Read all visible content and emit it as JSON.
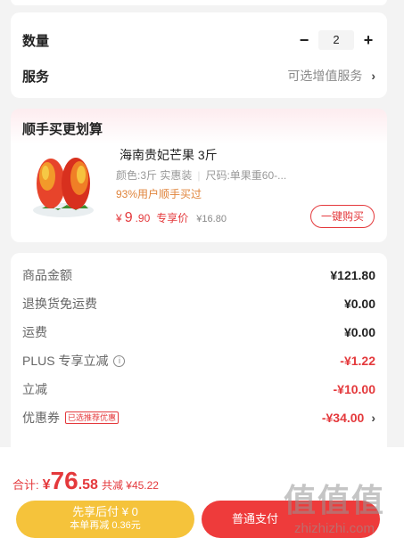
{
  "quantity": {
    "label": "数量",
    "minus": "−",
    "plus": "+",
    "value": "2"
  },
  "service": {
    "label": "服务",
    "value": "可选增值服务",
    "chevron": "›"
  },
  "bundle": {
    "title": "顺手买更划算",
    "product": {
      "name": "海南贵妃芒果 3斤",
      "spec_color": "颜色:3斤 实惠装",
      "spec_size": "尺码:单果重60-...",
      "buy_rate": "93%用户顺手买过",
      "price_yen": "¥",
      "price_int": "9",
      "price_dec": ".90",
      "price_tag": "专享价",
      "orig_price": "¥16.80",
      "buy_button": "一键购买"
    }
  },
  "summary": {
    "rows": [
      {
        "label": "商品金额",
        "value": "¥121.80"
      },
      {
        "label": "退换货免运费",
        "value": "¥0.00"
      },
      {
        "label": "运费",
        "value": "¥0.00"
      },
      {
        "label": "PLUS 专享立减",
        "value": "-¥1.22"
      },
      {
        "label": "立减",
        "value": "-¥10.00"
      },
      {
        "label": "优惠券",
        "tag": "已选推荐优惠",
        "value": "-¥34.00"
      }
    ]
  },
  "footer": {
    "total_label": "合计:",
    "total_yen": "¥",
    "total_int": "76",
    "total_dec": ".58",
    "save_text": "共减 ¥45.22",
    "pay_later_line1": "先享后付 ¥ 0",
    "pay_later_line2": "本单再减 0.36元",
    "normal_pay": "普通支付"
  },
  "watermark": {
    "line1": "值值值",
    "line2": "zhizhizhi.com"
  },
  "colors": {
    "accent": "#e4393c",
    "pay_later": "#f5c33b",
    "normal_pay": "#ee3b3b",
    "promo_text": "#e0843b"
  }
}
